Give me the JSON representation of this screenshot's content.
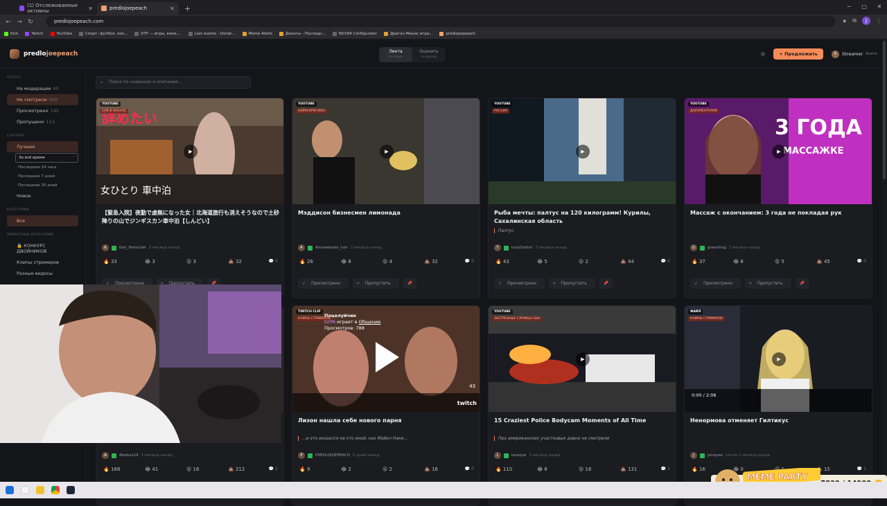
{
  "browser": {
    "tabs": [
      {
        "label": "(1) Отслеживаемые активны",
        "active": false
      },
      {
        "label": "predlojoepeach",
        "active": true
      }
    ],
    "url": "predlojoepeach.com",
    "bookmarks": [
      "Kick",
      "Twitch",
      "YouTube",
      "Спорт: футбол, хок...",
      "DTF — игры, кино,...",
      "Last events - Donat...",
      "Meme Alerts",
      "Донаты - Последн...",
      "ND184 Configurator",
      "Драгон Манис игра...",
      "predlojoepeach"
    ]
  },
  "header": {
    "logo_a": "predlo",
    "logo_b": "joepeach",
    "seg": [
      {
        "label": "Лента",
        "sub": "все видео"
      },
      {
        "label": "Оценить",
        "sub": "по одному"
      }
    ],
    "suggest": "+ Предложить",
    "user_initial": "S",
    "user_name": "Streamer",
    "logout": "Выйти"
  },
  "sidebar": {
    "status_title": "СТАТУС",
    "status": [
      {
        "label": "На модерации",
        "count": "40"
      },
      {
        "label": "Не смотрели",
        "count": "668"
      },
      {
        "label": "Просмотрено",
        "count": "145"
      },
      {
        "label": "Пропущено",
        "count": "113"
      }
    ],
    "first_title": "СНАЧАЛА",
    "best": "Лучшее",
    "periods": [
      "За всё время",
      "Последние 24 часа",
      "Последние 7 дней",
      "Последние 30 дней"
    ],
    "newest": "Новое",
    "cat_title": "КАТЕГОРИЯ",
    "all": "Все",
    "private_title": "ПРИВАТНЫЕ КАТЕГОРИИ",
    "cats": [
      "КОНКУРС ДВОЙНИКОВ",
      "Клипы стримеров",
      "Разные видосы"
    ]
  },
  "search": {
    "placeholder": "Поиск по названию и описанию..."
  },
  "actions": {
    "watched": "Просмотрено",
    "skip": "Пропустить"
  },
  "cards": [
    {
      "badge": "YOUTUBE",
      "cat": "СОК В КАНАЛЕ",
      "title": "【緊急入院】夜勤で虚無になった女｜北海道旅行も消えそうなので土砂降りの山でジンギスカン車中泊【しんどい】",
      "note": "",
      "user": "Karl_Henschel",
      "initial": "K",
      "ago": "2 месяца назад",
      "r": [
        "33",
        "3",
        "3",
        "32"
      ],
      "comments": "0"
    },
    {
      "badge": "YOUTUBE",
      "cat": "НЕЙРОХРЮЧЕВО",
      "title": "Мэддисон бизнесмен лимонада",
      "note": "",
      "user": "Arrowwoods_hair",
      "initial": "A",
      "ago": "2 месяца назад",
      "r": [
        "26",
        "8",
        "4",
        "32"
      ],
      "comments": "0"
    },
    {
      "badge": "YOUTUBE",
      "cat": "РОССИЯ",
      "title": "Рыба мечты: палтус на 120 килограмм! Курилы, Сахалинская область",
      "note": "Палтус",
      "user": "tvoyDoktor",
      "initial": "T",
      "ago": "2 месяца назад",
      "r": [
        "43",
        "5",
        "2",
        "44"
      ],
      "comments": "0"
    },
    {
      "badge": "YOUTUBE",
      "cat": "ДОКУМЕНТАЛКИ",
      "title": "Массаж с окончанием: 3 года не покладая рук",
      "note": "",
      "user": "greenfrog",
      "initial": "G",
      "ago": "2 месяца назад",
      "r": [
        "37",
        "8",
        "5",
        "45"
      ],
      "comments": "0"
    },
    {
      "badge": "YOUTUBE",
      "cat": "",
      "title": "",
      "note": "",
      "user": "Abobus24",
      "initial": "A",
      "ago": "2 месяца назад",
      "r": [
        "168",
        "41",
        "16",
        "212"
      ],
      "comments": "2"
    },
    {
      "badge": "TWITCH CLIP",
      "cat": "КЛИПЫ СТРИМЕРОВ",
      "title": "Лизон нашла себе нового парня",
      "note": "...и это оказался не кто иной, как Майкл Наки...",
      "user": "PREDLOJOEPEACH",
      "initial": "P",
      "ago": "6 дней назад",
      "r": [
        "9",
        "2",
        "2",
        "18"
      ],
      "comments": "0"
    },
    {
      "badge": "YOUTUBE",
      "cat": "ЭКСТРЕННЫЕ СЛУЖБЫ США",
      "title": "15 Craziest Police Bodycam Moments of All Time",
      "note": "Про американских участковых давно не смотрели",
      "user": "lesaque",
      "initial": "L",
      "ago": "2 месяца назад",
      "r": [
        "110",
        "8",
        "16",
        "131"
      ],
      "comments": "1"
    },
    {
      "badge": "ФАЙЛ",
      "cat": "КЛИПЫ СТРИМЕРОВ",
      "title": "Ненормова отменяет Гилтикус",
      "note": "",
      "user": "jenquee",
      "initial": "J",
      "ago": "около 1 месяца назад",
      "r": [
        "16",
        "0",
        "1",
        "15"
      ],
      "comments": "1"
    }
  ],
  "twitch": {
    "title": "Поцелуйчик",
    "streamer": "liz0N",
    "plays": "играет в",
    "game": "Общение",
    "views": "Просмотров: 788",
    "counter": "43",
    "brand": "twitch"
  },
  "player": {
    "time": "0:00 / 2:06"
  },
  "overlay": {
    "meme_party": "MEME PARTY",
    "score": "7830 / 14900"
  },
  "colors": {
    "accent": "#f58b5a",
    "ok": "#2fb35a"
  }
}
